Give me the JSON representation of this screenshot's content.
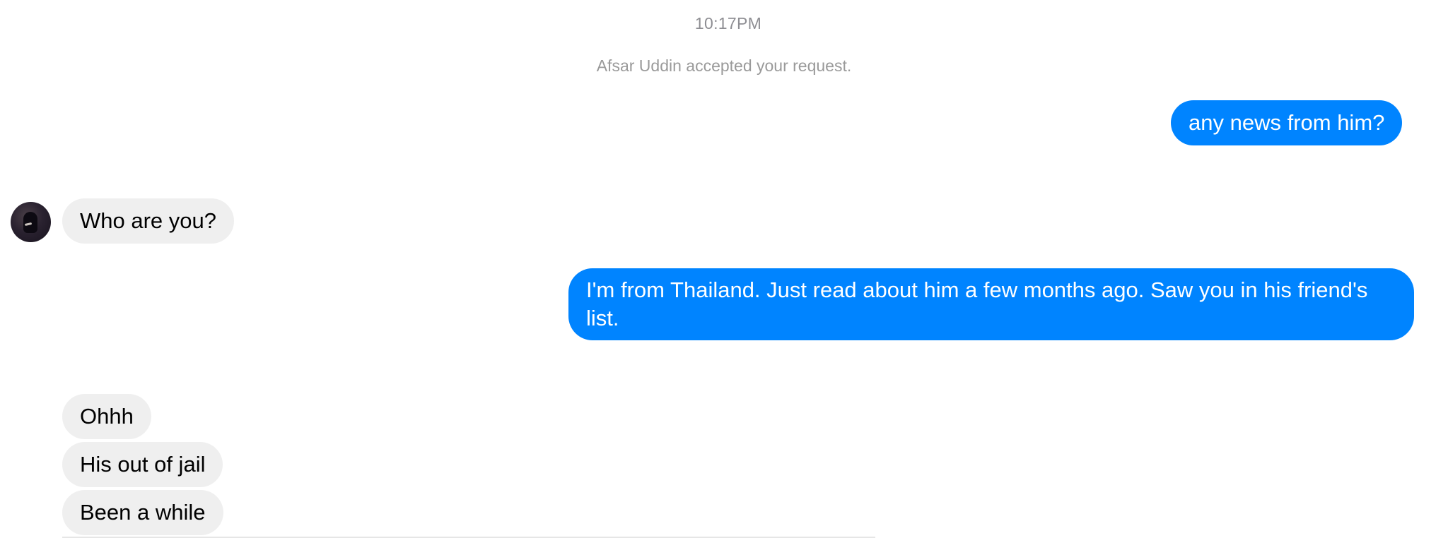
{
  "conversation": {
    "timestamp": "10:17PM",
    "system_message": "Afsar Uddin accepted your request.",
    "messages": [
      {
        "direction": "outgoing",
        "text": "any news from him?"
      },
      {
        "direction": "incoming",
        "text": "Who are you?"
      },
      {
        "direction": "outgoing",
        "text": "I'm from Thailand. Just read about him a few months ago. Saw you in his friend's list."
      },
      {
        "direction": "incoming",
        "text": "Ohhh"
      },
      {
        "direction": "incoming",
        "text": "His out of jail"
      },
      {
        "direction": "incoming",
        "text": "Been a while"
      }
    ]
  },
  "colors": {
    "outgoing_bubble": "#0084ff",
    "incoming_bubble": "#efefef",
    "meta_text": "#8e8e93"
  },
  "contact": {
    "avatar_icon": "contact-avatar"
  }
}
